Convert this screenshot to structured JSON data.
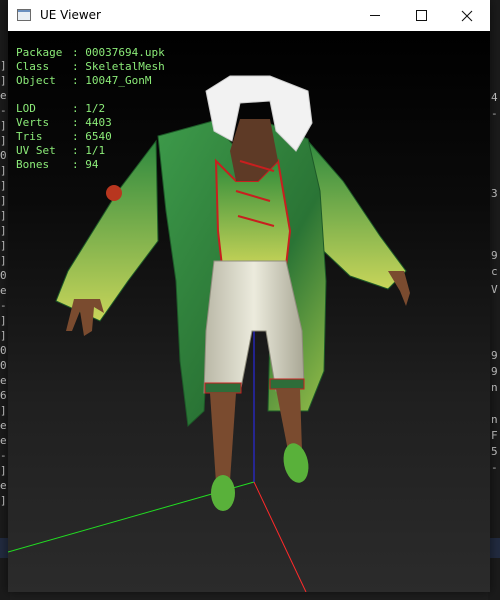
{
  "window": {
    "title": "UE Viewer",
    "controls": {
      "minimize": "minimize",
      "maximize": "maximize",
      "close": "close"
    }
  },
  "info": {
    "package": {
      "key": "Package",
      "value": "00037694.upk"
    },
    "class": {
      "key": "Class",
      "value": "SkeletalMesh"
    },
    "object": {
      "key": "Object",
      "value": "10047_GonM"
    },
    "lod": {
      "key": "LOD",
      "value": "1/2"
    },
    "verts": {
      "key": "Verts",
      "value": "4403"
    },
    "tris": {
      "key": "Tris",
      "value": "6540"
    },
    "uvset": {
      "key": "UV Set",
      "value": "1/1"
    },
    "bones": {
      "key": "Bones",
      "value": "94"
    }
  },
  "background_text": {
    "left": [
      "]",
      "]",
      "e",
      "-",
      "]",
      "]",
      "0",
      "]",
      "]",
      "]",
      "]",
      "]",
      "]",
      "]",
      "0",
      "e",
      "-",
      "]",
      "]",
      "0",
      "0",
      "e",
      "6",
      "]",
      "e",
      "e",
      "-",
      "]",
      "e",
      "]"
    ],
    "right": [
      "4",
      "-",
      "3",
      "9",
      "c",
      "V",
      "9",
      "9",
      "n",
      "n",
      "F",
      "5",
      "-"
    ]
  },
  "colors": {
    "info_text": "#8cec79",
    "axis_x": "#ff2a2a",
    "axis_y": "#22dd22",
    "axis_z": "#2a2aff",
    "robe": "#2e7a3a",
    "fur": "#f2f2f2",
    "pants": "#d9d7c6",
    "trim": "#c81f1f",
    "skin": "#8a5a3c"
  }
}
